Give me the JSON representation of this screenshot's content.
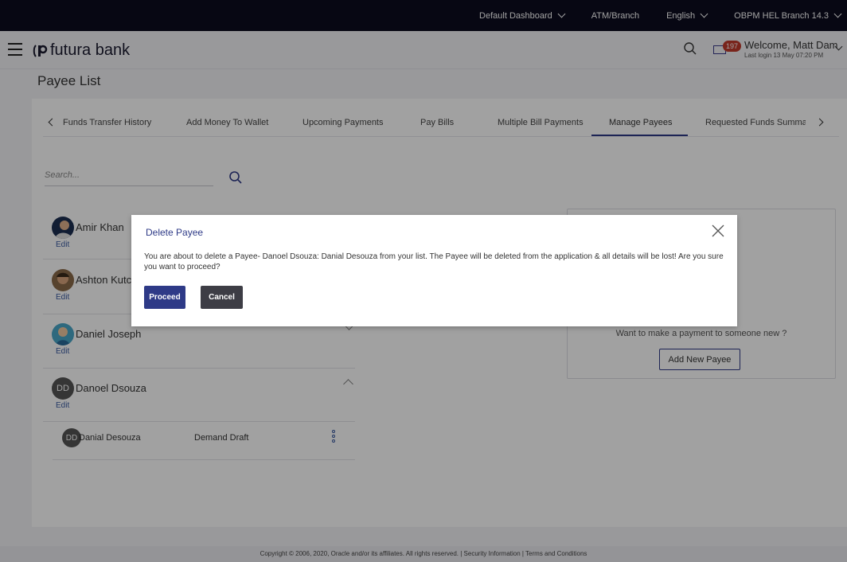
{
  "topbar": {
    "dashboard": "Default Dashboard",
    "atm": "ATM/Branch",
    "language": "English",
    "branch": "OBPM HEL Branch 14.3"
  },
  "header": {
    "brand": "futura bank",
    "notifications_count": "197",
    "welcome": "Welcome, Matt Dam",
    "last_login": "Last login 13 May 07:20 PM"
  },
  "page": {
    "title": "Payee List"
  },
  "tabs": [
    {
      "label": "Funds Transfer History"
    },
    {
      "label": "Add Money To Wallet"
    },
    {
      "label": "Upcoming Payments"
    },
    {
      "label": "Pay Bills"
    },
    {
      "label": "Multiple Bill Payments"
    },
    {
      "label": "Manage Payees",
      "active": true
    },
    {
      "label": "Requested Funds Summai"
    }
  ],
  "search": {
    "placeholder": "Search..."
  },
  "payees": [
    {
      "name": "Amir Khan",
      "edit": "Edit"
    },
    {
      "name": "Ashton Kutcl",
      "edit": "Edit"
    },
    {
      "name": "Daniel Joseph",
      "edit": "Edit"
    },
    {
      "name": "Danoel Dsouza",
      "initials": "DD",
      "edit": "Edit",
      "sub": {
        "initials": "DD",
        "name": "Danial Desouza",
        "type": "Demand Draft"
      }
    }
  ],
  "side_panel": {
    "prompt": "Want to make a payment to someone new ?",
    "add_button": "Add New Payee"
  },
  "modal": {
    "title": "Delete Payee",
    "message": "You are about to delete a Payee- Danoel Dsouza: Danial Desouza from your list. The Payee will be deleted from the application & all details will be lost! Are you sure you want to proceed?",
    "proceed": "Proceed",
    "cancel": "Cancel"
  },
  "footer": {
    "text": "Copyright © 2006, 2020, Oracle and/or its affiliates. All rights reserved. | Security Information | Terms and Conditions"
  },
  "colors": {
    "primary": "#2e3a87",
    "topbar": "#0c0c1f",
    "badge": "#c0392b"
  }
}
